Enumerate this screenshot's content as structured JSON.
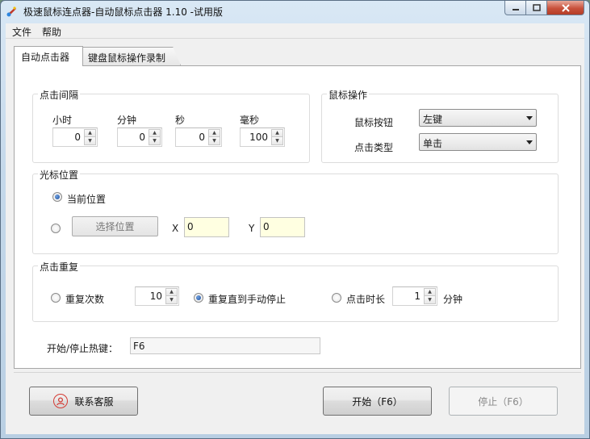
{
  "window": {
    "title": "极速鼠标连点器-自动鼠标点击器 1.10  -试用版"
  },
  "menu": {
    "file": "文件",
    "help": "帮助"
  },
  "tabs": [
    {
      "label": "自动点击器",
      "active": true
    },
    {
      "label": "键盘鼠标操作录制",
      "active": false
    }
  ],
  "interval": {
    "title": "点击间隔",
    "hours_label": "小时",
    "hours": "0",
    "minutes_label": "分钟",
    "minutes": "0",
    "seconds_label": "秒",
    "seconds": "0",
    "ms_label": "毫秒",
    "ms": "100"
  },
  "mouse_op": {
    "title": "鼠标操作",
    "button_label": "鼠标按钮",
    "button_value": "左键",
    "click_type_label": "点击类型",
    "click_type_value": "单击"
  },
  "cursor": {
    "title": "光标位置",
    "current_label": "当前位置",
    "select_button": "选择位置",
    "x_label": "X",
    "x_value": "0",
    "y_label": "Y",
    "y_value": "0"
  },
  "repeat": {
    "title": "点击重复",
    "times_label": "重复次数",
    "times_value": "10",
    "until_stop_label": "重复直到手动停止",
    "duration_label": "点击时长",
    "duration_value": "1",
    "duration_unit": "分钟"
  },
  "hotkey": {
    "label": "开始/停止热键：",
    "value": "F6"
  },
  "buttons": {
    "support": "联系客服",
    "start": "开始（F6）",
    "stop": "停止（F6）"
  },
  "colors": {
    "accent_red": "#d43b34",
    "input_yellow": "#ffffe1"
  },
  "icons": [
    "app-icon",
    "minimize-icon",
    "maximize-icon",
    "close-icon",
    "customer-service-icon"
  ]
}
